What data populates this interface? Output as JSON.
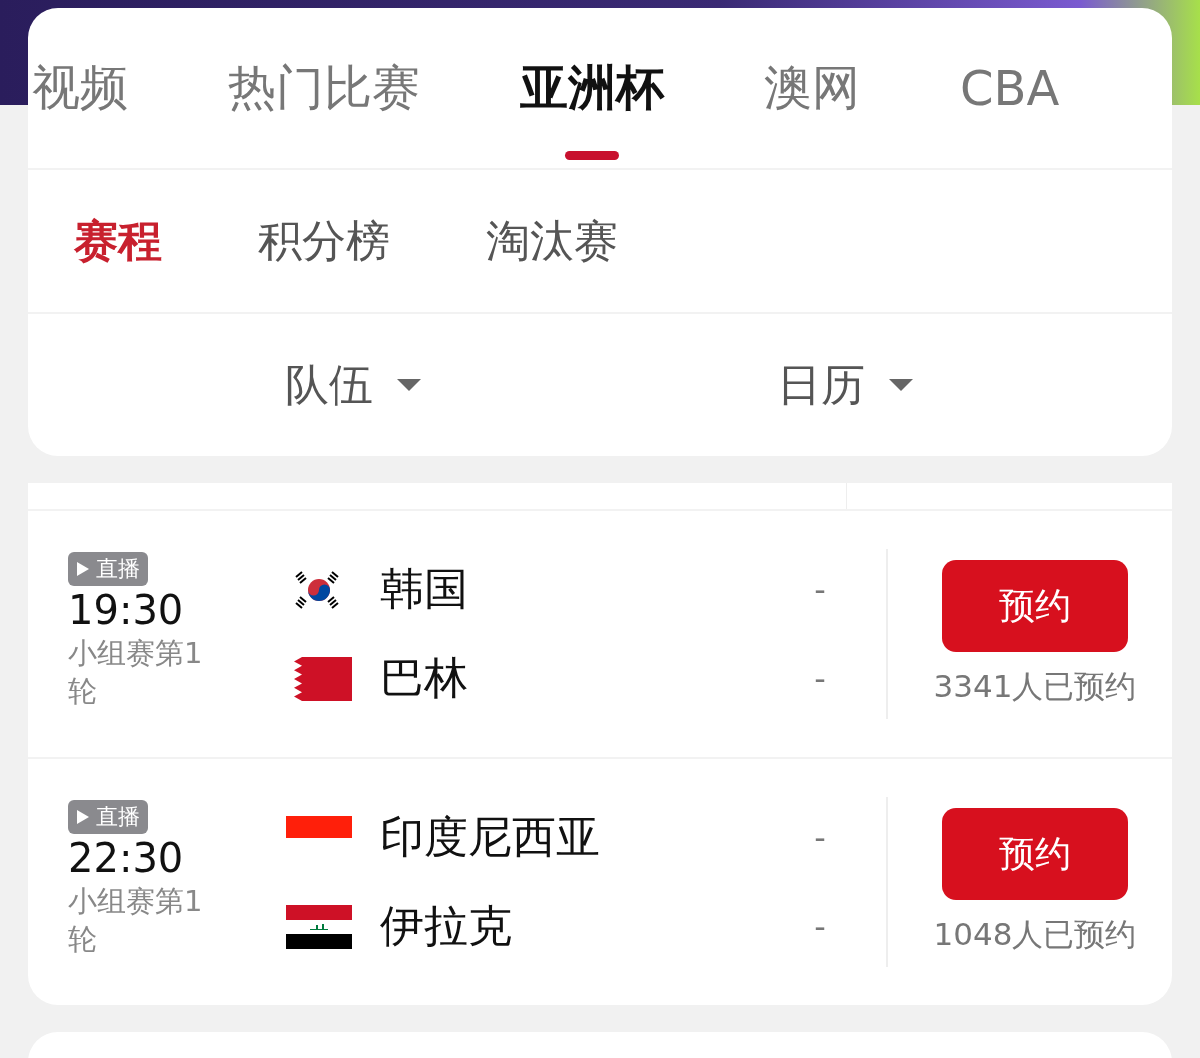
{
  "tabs": [
    {
      "label": "视频",
      "selected": false
    },
    {
      "label": "热门比赛",
      "selected": false
    },
    {
      "label": "亚洲杯",
      "selected": true
    },
    {
      "label": "澳网",
      "selected": false
    },
    {
      "label": "CBA",
      "selected": false
    }
  ],
  "subtabs": [
    {
      "label": "赛程",
      "selected": true
    },
    {
      "label": "积分榜",
      "selected": false
    },
    {
      "label": "淘汰赛",
      "selected": false
    }
  ],
  "filters": [
    {
      "label": "队伍"
    },
    {
      "label": "日历"
    }
  ],
  "matches": [
    {
      "badge": "直播",
      "time": "19:30",
      "round": "小组赛第1轮",
      "teams": [
        {
          "name": "韩国",
          "kind": "kr",
          "score": "-"
        },
        {
          "name": "巴林",
          "kind": "bh",
          "score": "-"
        }
      ],
      "button": "预约",
      "reservations": "3341人已预约"
    },
    {
      "badge": "直播",
      "time": "22:30",
      "round": "小组赛第1轮",
      "teams": [
        {
          "name": "印度尼西亚",
          "kind": "id",
          "score": "-"
        },
        {
          "name": "伊拉克",
          "kind": "iq",
          "score": "-"
        }
      ],
      "button": "预约",
      "reservations": "1048人已预约"
    }
  ]
}
